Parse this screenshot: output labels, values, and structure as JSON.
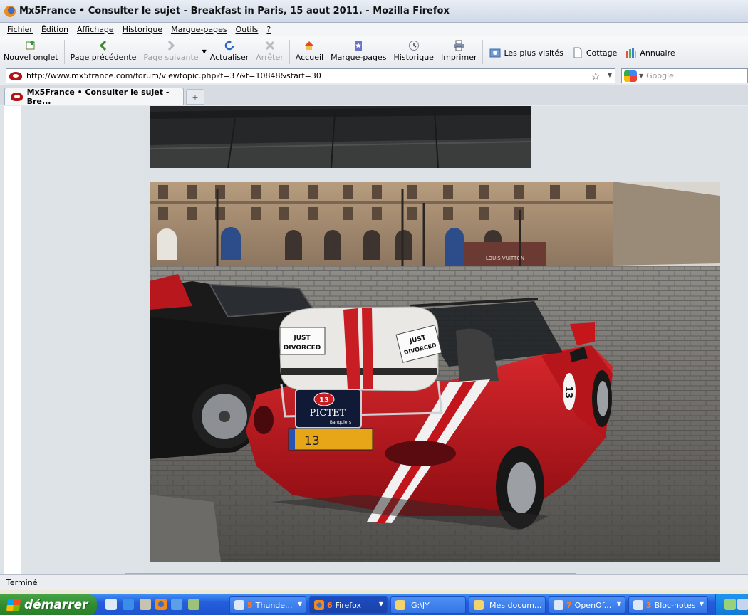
{
  "window": {
    "title": "Mx5France • Consulter le sujet - Breakfast in Paris, 15 aout 2011. - Mozilla Firefox"
  },
  "menu": [
    "Fichier",
    "Édition",
    "Affichage",
    "Historique",
    "Marque-pages",
    "Outils",
    "?"
  ],
  "toolbar": {
    "new_tab": "Nouvel onglet",
    "back": "Page précédente",
    "forward": "Page suivante",
    "reload": "Actualiser",
    "stop": "Arrêter",
    "home": "Accueil",
    "bookmarks": "Marque-pages",
    "history": "Historique",
    "print": "Imprimer"
  },
  "bookmarks_bar": [
    "Les plus visités",
    "Cottage",
    "Annuaire"
  ],
  "address": {
    "url": "http://www.mx5france.com/forum/viewtopic.php?f=37&t=10848&start=30"
  },
  "search": {
    "placeholder": "Google"
  },
  "tabs": [
    {
      "label": "Mx5France • Consulter le sujet - Bre..."
    }
  ],
  "photo": {
    "sign_left": "JUST DIVORCED",
    "sign_right": "JUST DIVORCED",
    "store_sign": "LOUIS VUITTON",
    "race_number": "13",
    "plate_text": "PICTET",
    "plate_subtext": "Banquiers",
    "license_plate": "13"
  },
  "status": {
    "text": "Terminé"
  },
  "taskbar": {
    "start_label": "démarrer",
    "tasks": [
      {
        "count": "5",
        "label": "Thunde..."
      },
      {
        "count": "6",
        "label": "Firefox"
      },
      {
        "count": "",
        "label": "G:\\JY"
      },
      {
        "count": "",
        "label": "Mes docum..."
      },
      {
        "count": "7",
        "label": "OpenOf..."
      },
      {
        "count": "3",
        "label": "Bloc-notes"
      }
    ]
  },
  "colors": {
    "car_red": "#c3161c",
    "taskbar_blue": "#245edb",
    "start_green": "#2f8d2f"
  }
}
